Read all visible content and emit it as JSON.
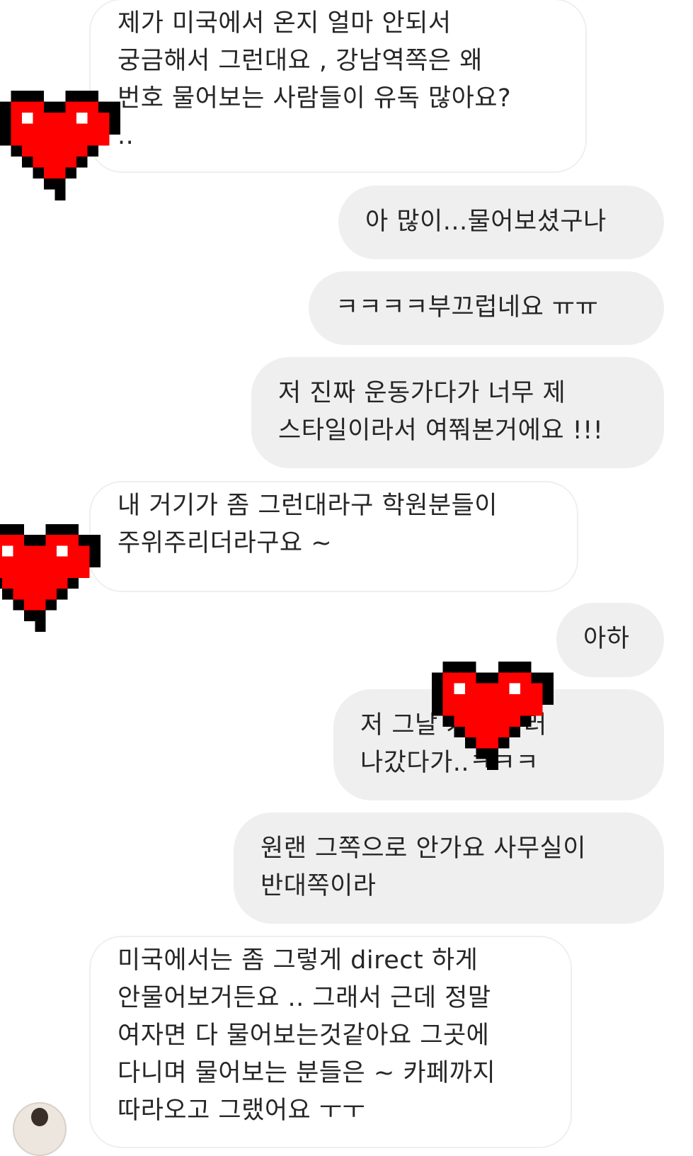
{
  "messages": [
    {
      "side": "incoming",
      "text": "제가 미국에서 온지 얼마 안되서\n궁금해서 그런대요 , 강남역쪽은 왜\n번호 물어보는 사람들이 유독 많아요?\n.."
    },
    {
      "side": "outgoing",
      "text": "아 많이...물어보셨구나"
    },
    {
      "side": "outgoing",
      "text": "ㅋㅋㅋㅋ부끄럽네요 ㅠㅠ"
    },
    {
      "side": "outgoing",
      "text": "저 진짜 운동가다가 너무 제\n스타일이라서 여쭤본거에요 !!!"
    },
    {
      "side": "incoming",
      "text": "내 거기가 좀 그런대라구 학원분들이\n주위주리더라구요 ~"
    },
    {
      "side": "outgoing",
      "text": "아하"
    },
    {
      "side": "outgoing",
      "text": "저 그날 커피 사러\n나갔다가..ㅋㅋㅋ"
    },
    {
      "side": "outgoing",
      "text": "원랜 그쪽으로 안가요 사무실이\n반대쪽이라"
    },
    {
      "side": "incoming",
      "text": "미국에서는 좀 그렇게 direct 하게\n안물어보거든요 .. 그래서 근데 정말\n여자면 다 물어보는것같아요 그곳에\n다니며 물어보는 분들은 ~ 카페까지\n따라오고 그랬어요 ㅜㅜ"
    }
  ],
  "colors": {
    "incoming_bubble": "#ffffff",
    "incoming_border": "#efefef",
    "outgoing_bubble": "#efefef",
    "text": "#262626",
    "heart_red": "#ff0000",
    "heart_outline": "#000000"
  },
  "icons": {
    "censor_sticker": "pixel-heart-icon",
    "profile": "avatar"
  }
}
